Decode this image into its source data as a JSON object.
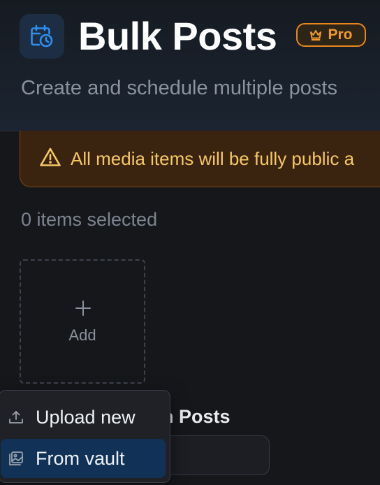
{
  "header": {
    "title": "Bulk Posts",
    "badge_label": "Pro",
    "subtitle": "Create and schedule multiple posts"
  },
  "warning": {
    "text": "All media items will be fully public a"
  },
  "media": {
    "selection_count": "0 items selected",
    "add_label": "Add",
    "add_symbol": "+"
  },
  "section": {
    "partial_label": "n Posts"
  },
  "upload_menu": {
    "items": [
      {
        "label": "Upload new",
        "icon": "upload-icon"
      },
      {
        "label": "From vault",
        "icon": "image-gallery-icon",
        "highlighted": true
      }
    ]
  },
  "colors": {
    "background": "#16171b",
    "accent_blue": "#2f8ff0",
    "pro_orange": "#e8871e",
    "warning_text": "#f6c865",
    "menu_highlight": "#113256"
  }
}
